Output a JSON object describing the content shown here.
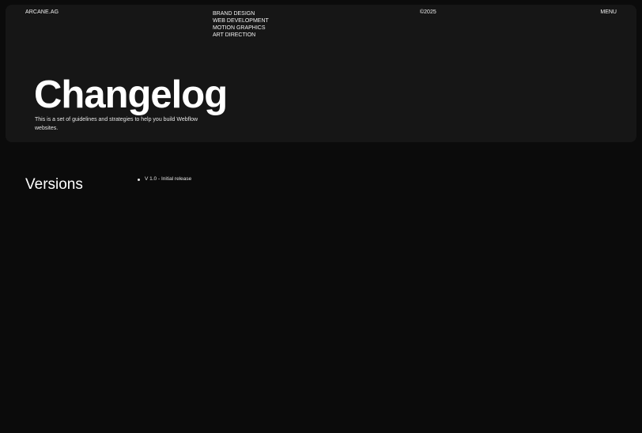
{
  "header": {
    "brand": "ARCANE.AG",
    "services": [
      "BRAND DESIGN",
      "WEB DEVELOPMENT",
      "MOTION GRAPHICS",
      "ART DIRECTION"
    ],
    "year": "©2025",
    "menu_label": "MENU"
  },
  "hero": {
    "title": "Changelog",
    "description": "This is a set of guidelines and strategies to help you build Webflow websites."
  },
  "versions": {
    "heading": "Versions",
    "items": [
      {
        "label": "V 1.0 - Initial release"
      }
    ]
  },
  "colors": {
    "background": "#0b0b0b",
    "panel": "#161616",
    "text": "#f2f2f2"
  }
}
